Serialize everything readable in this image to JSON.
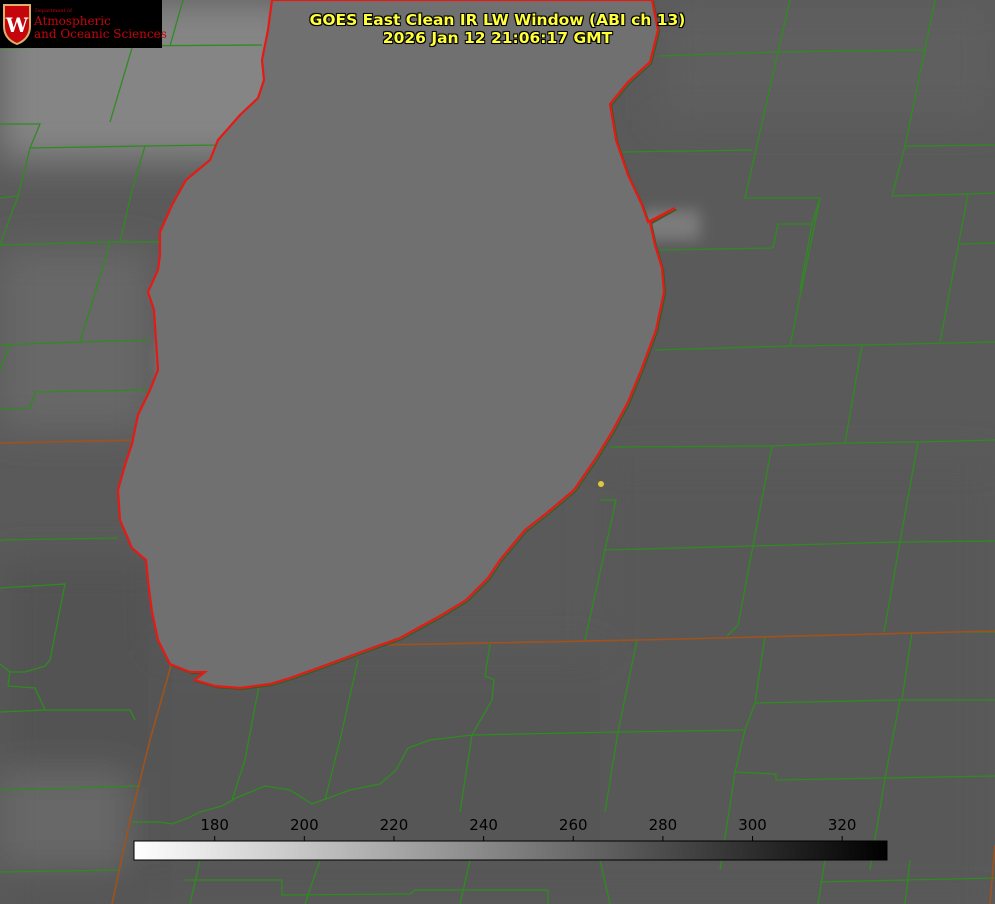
{
  "title": {
    "line1": "GOES East Clean IR LW Window (ABI ch 13)",
    "line2": "2026 Jan 12 21:06:17 GMT"
  },
  "logo": {
    "department": "Department of",
    "line1": "Atmospheric",
    "line2": "and Oceanic Sciences",
    "crest_letter": "W"
  },
  "colorbar": {
    "ticks": [
      180,
      200,
      220,
      240,
      260,
      280,
      300,
      320
    ],
    "range": [
      162,
      330
    ],
    "cmap": "white-to-black"
  },
  "colors": {
    "county_lines": "#2f8b20",
    "state_lines": "#a0521d",
    "lake_outline": "#e51a14",
    "title_text": "#ffff3a",
    "marker": "#e0c83a"
  }
}
